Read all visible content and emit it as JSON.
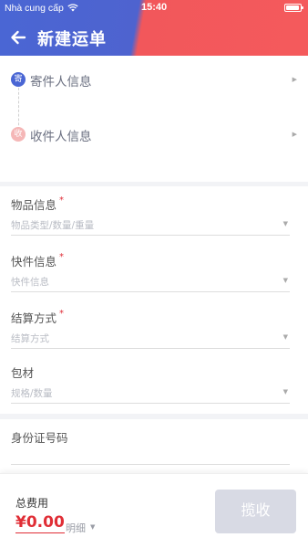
{
  "status_bar": {
    "carrier": "Nhà cung cấp",
    "time": "15:40"
  },
  "header": {
    "title": "新建运单",
    "gradient_colors": [
      "#4a66d4",
      "#f45a5c"
    ]
  },
  "contacts": {
    "sender": {
      "badge": "寄",
      "label": "寄件人信息",
      "badge_color": "#4a66d4"
    },
    "receiver": {
      "badge": "收",
      "label": "收件人信息",
      "badge_color": "#f5b7b7"
    }
  },
  "form": {
    "required_mark": "*",
    "fields": [
      {
        "label": "物品信息",
        "required": true,
        "placeholder": "物品类型/数量/重量"
      },
      {
        "label": "快件信息",
        "required": true,
        "placeholder": "快件信息"
      },
      {
        "label": "结算方式",
        "required": true,
        "placeholder": "结算方式"
      },
      {
        "label": "包材",
        "required": false,
        "placeholder": "规格/数量"
      }
    ],
    "id_number": {
      "label": "身份证号码",
      "value": ""
    }
  },
  "footer": {
    "fee_label": "总费用",
    "fee_amount": "¥0.00",
    "details_label": "明细",
    "submit_label": "揽收",
    "accent_color": "#e02e36"
  }
}
